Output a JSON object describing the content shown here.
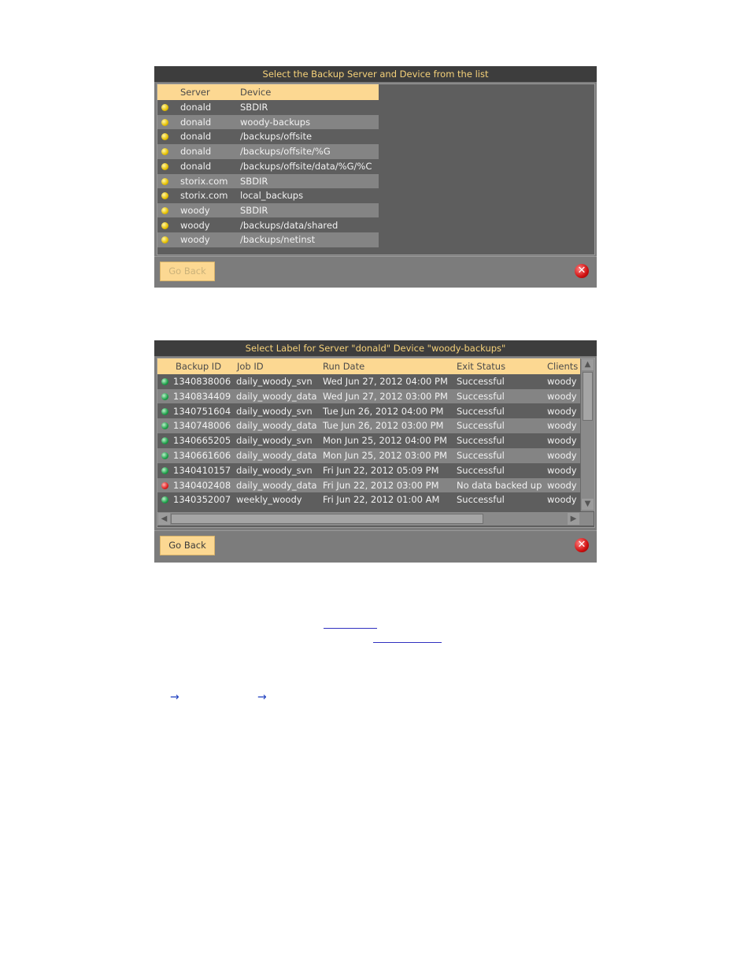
{
  "panel1": {
    "title": "Select the Backup Server and Device from the list",
    "columns": [
      "Server",
      "Device"
    ],
    "rows": [
      {
        "server": "donald",
        "device": "SBDIR"
      },
      {
        "server": "donald",
        "device": "woody-backups"
      },
      {
        "server": "donald",
        "device": "/backups/offsite"
      },
      {
        "server": "donald",
        "device": "/backups/offsite/%G"
      },
      {
        "server": "donald",
        "device": "/backups/offsite/data/%G/%C"
      },
      {
        "server": "storix.com",
        "device": "SBDIR"
      },
      {
        "server": "storix.com",
        "device": "local_backups"
      },
      {
        "server": "woody",
        "device": "SBDIR"
      },
      {
        "server": "woody",
        "device": "/backups/data/shared"
      },
      {
        "server": "woody",
        "device": "/backups/netinst"
      }
    ],
    "go_back_label": "Go Back",
    "close_icon": "close-icon"
  },
  "panel2": {
    "title": "Select Label for Server \"donald\" Device \"woody-backups\"",
    "columns": [
      "Backup ID",
      "Job ID",
      "Run Date",
      "Exit Status",
      "Clients"
    ],
    "rows": [
      {
        "status": "green",
        "backup_id": "1340838006",
        "job_id": "daily_woody_svn",
        "run_date": "Wed Jun 27, 2012 04:00 PM",
        "exit_status": "Successful",
        "clients": "woody"
      },
      {
        "status": "green",
        "backup_id": "1340834409",
        "job_id": "daily_woody_data",
        "run_date": "Wed Jun 27, 2012 03:00 PM",
        "exit_status": "Successful",
        "clients": "woody"
      },
      {
        "status": "green",
        "backup_id": "1340751604",
        "job_id": "daily_woody_svn",
        "run_date": "Tue Jun 26, 2012 04:00 PM",
        "exit_status": "Successful",
        "clients": "woody"
      },
      {
        "status": "green",
        "backup_id": "1340748006",
        "job_id": "daily_woody_data",
        "run_date": "Tue Jun 26, 2012 03:00 PM",
        "exit_status": "Successful",
        "clients": "woody"
      },
      {
        "status": "green",
        "backup_id": "1340665205",
        "job_id": "daily_woody_svn",
        "run_date": "Mon Jun 25, 2012 04:00 PM",
        "exit_status": "Successful",
        "clients": "woody"
      },
      {
        "status": "green",
        "backup_id": "1340661606",
        "job_id": "daily_woody_data",
        "run_date": "Mon Jun 25, 2012 03:00 PM",
        "exit_status": "Successful",
        "clients": "woody"
      },
      {
        "status": "green",
        "backup_id": "1340410157",
        "job_id": "daily_woody_svn",
        "run_date": "Fri Jun 22, 2012 05:09 PM",
        "exit_status": "Successful",
        "clients": "woody"
      },
      {
        "status": "red",
        "backup_id": "1340402408",
        "job_id": "daily_woody_data",
        "run_date": "Fri Jun 22, 2012 03:00 PM",
        "exit_status": "No data backed up",
        "clients": "woody"
      },
      {
        "status": "green",
        "backup_id": "1340352007",
        "job_id": "weekly_woody",
        "run_date": "Fri Jun 22, 2012 01:00 AM",
        "exit_status": "Successful",
        "clients": "woody"
      }
    ],
    "go_back_label": "Go Back",
    "close_icon": "close-icon"
  },
  "colors": {
    "header_bg": "#fcd892",
    "title_bg": "#3d3d3d",
    "title_text": "#f6d27a",
    "row_bg": "#5e5e5e",
    "row_alt_bg": "#848484",
    "link": "#3030c0"
  }
}
